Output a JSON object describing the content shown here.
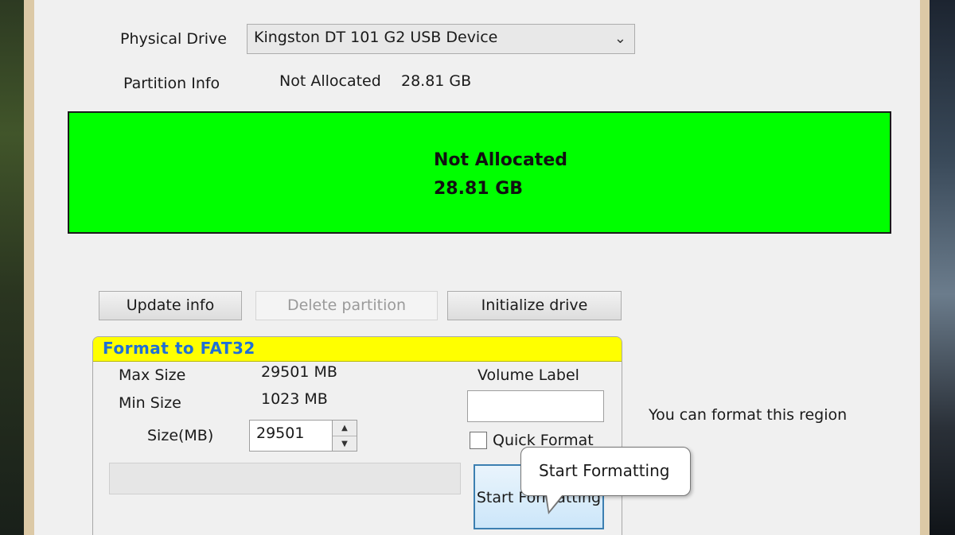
{
  "drive": {
    "label": "Physical Drive",
    "selected": "Kingston DT 101 G2 USB Device"
  },
  "partition": {
    "label": "Partition Info",
    "status": "Not Allocated",
    "size": "28.81 GB"
  },
  "bar": {
    "status": "Not Allocated",
    "size": "28.81 GB",
    "color": "#00ff00"
  },
  "buttons": {
    "update": "Update info",
    "delete": "Delete partition",
    "initialize": "Initialize drive"
  },
  "format_group": {
    "title": "Format to FAT32",
    "max_label": "Max Size",
    "max_value": "29501 MB",
    "min_label": "Min Size",
    "min_value": "1023 MB",
    "size_label": "Size(MB)",
    "size_value": "29501",
    "volume_label": "Volume Label",
    "volume_value": "",
    "quick_format": "Quick Format",
    "quick_format_checked": false,
    "start_button": "Start Formatting"
  },
  "hint": "You can format this region",
  "tooltip": "Start Formatting"
}
